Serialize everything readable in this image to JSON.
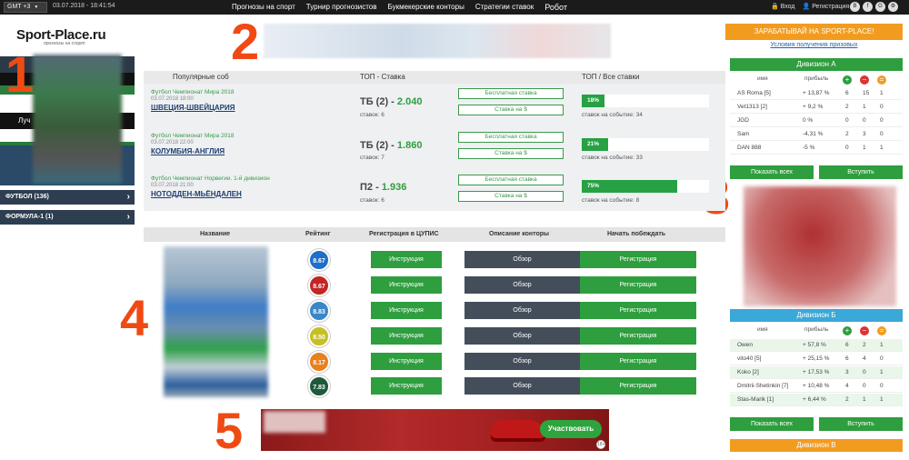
{
  "topbar": {
    "timezone": "GMT +3",
    "datetime": "03.07.2018 - 18:41:54",
    "nav": [
      "Прогнозы на спорт",
      "Турнир прогнозистов",
      "Букмекерские конторы",
      "Стратегии ставок",
      "Робот"
    ],
    "login": "Вход",
    "register": "Регистрация",
    "social": [
      "В",
      "f",
      "G",
      "⚙"
    ]
  },
  "logo": {
    "main": "Sport-Place.ru",
    "sub": "прогнозы на спорт"
  },
  "sidebar": {
    "partial_label": "Луч",
    "sports": [
      {
        "label": "ФУТБОЛ (136)"
      },
      {
        "label": "ФОРМУЛА-1 (1)"
      }
    ]
  },
  "annotations": [
    "1",
    "2",
    "3",
    "4",
    "5"
  ],
  "popular": {
    "header": {
      "events": "Популярные соб",
      "top_bet": "ТОП - Ставка",
      "top_all": "ТОП / Все ставки"
    },
    "events": [
      {
        "league": "Футбол Чемпионат Мира 2018",
        "date": "03.07.2018 18:00",
        "title": "ШВЕЦИЯ-ШВЕЙЦАРИЯ",
        "bet": "ТБ (2) -",
        "odds": "2.040",
        "bets_count": "ставок: 6",
        "free_bet": "Бесплатная ставка",
        "money_bet": "Ставка на $",
        "percent": "18%",
        "percent_value": 18,
        "bets_on_event": "ставок на событие: 34"
      },
      {
        "league": "Футбол Чемпионат Мира 2018",
        "date": "03.07.2018 22:00",
        "title": "КОЛУМБИЯ-АНГЛИЯ",
        "bet": "ТБ (2) -",
        "odds": "1.860",
        "bets_count": "ставок: 7",
        "free_bet": "Бесплатная ставка",
        "money_bet": "Ставка на $",
        "percent": "21%",
        "percent_value": 21,
        "bets_on_event": "ставок на событие: 33"
      },
      {
        "league": "Футбол Чемпионат Норвегии. 1-й дивизион",
        "date": "03.07.2018 21:00",
        "title": "НОТОДДЕН-МЬЁНДАЛЕН",
        "bet": "П2 -",
        "odds": "1.936",
        "bets_count": "ставок: 6",
        "free_bet": "Бесплатная ставка",
        "money_bet": "Ставка на $",
        "percent": "75%",
        "percent_value": 75,
        "bets_on_event": "ставок на событие: 8"
      }
    ]
  },
  "bookmakers": {
    "header": {
      "name": "Название",
      "rating": "Рейтинг",
      "registration": "Регистрация в ЦУПИС",
      "description": "Описание конторы",
      "start": "Начать побеждать"
    },
    "rows": [
      {
        "rating": "8.67",
        "color": "#1e6fc8",
        "instruction": "Инструкция",
        "review": "Обзор",
        "register": "Регистрация"
      },
      {
        "rating": "8.67",
        "color": "#c42424",
        "instruction": "Инструкция",
        "review": "Обзор",
        "register": "Регистрация"
      },
      {
        "rating": "8.83",
        "color": "#3a86c8",
        "instruction": "Инструкция",
        "review": "Обзор",
        "register": "Регистрация"
      },
      {
        "rating": "8.50",
        "color": "#c8c020",
        "instruction": "Инструкция",
        "review": "Обзор",
        "register": "Регистрация"
      },
      {
        "rating": "8.17",
        "color": "#e8801c",
        "instruction": "Инструкция",
        "review": "Обзор",
        "register": "Регистрация"
      },
      {
        "rating": "7.83",
        "color": "#1e5a3a",
        "instruction": "Инструкция",
        "review": "Обзор",
        "register": "Регистрация"
      }
    ]
  },
  "banner": {
    "participate": "Участвовать",
    "badge": "18+"
  },
  "right": {
    "earn": "ЗАРАБАТЫВАЙ НА SPORT-PLACE!",
    "earn_link": "Условия получения призовых",
    "columns": {
      "name": "имя",
      "profit": "прибыль"
    },
    "division_a": {
      "title": "Дивизион А",
      "color": "#2e9e3e",
      "rows": [
        {
          "name": "AS Roma [5]",
          "profit": "+ 13,87 %",
          "w": "6",
          "l": "15",
          "d": "1"
        },
        {
          "name": "Vet1313 [2]",
          "profit": "+ 9,2 %",
          "w": "2",
          "l": "1",
          "d": "0"
        },
        {
          "name": "JGD",
          "profit": "0 %",
          "w": "0",
          "l": "0",
          "d": "0"
        },
        {
          "name": "Sam",
          "profit": "-4,31 %",
          "w": "2",
          "l": "3",
          "d": "0"
        },
        {
          "name": "DAN 888",
          "profit": "-5 %",
          "w": "0",
          "l": "1",
          "d": "1"
        }
      ],
      "show_all": "Показать всех",
      "join": "Вступить"
    },
    "division_b": {
      "title": "Дивизион Б",
      "color": "#3aa8d8",
      "rows": [
        {
          "name": "Owen",
          "profit": "+ 57,8 %",
          "w": "6",
          "l": "2",
          "d": "1"
        },
        {
          "name": "vito40 [5]",
          "profit": "+ 25,15 %",
          "w": "6",
          "l": "4",
          "d": "0"
        },
        {
          "name": "Koko [2]",
          "profit": "+ 17,53 %",
          "w": "3",
          "l": "0",
          "d": "1"
        },
        {
          "name": "Dmitrii-Shetinkin [7]",
          "profit": "+ 10,48 %",
          "w": "4",
          "l": "0",
          "d": "0"
        },
        {
          "name": "Stas-Marik [1]",
          "profit": "+ 6,44 %",
          "w": "2",
          "l": "1",
          "d": "1"
        }
      ],
      "show_all": "Показать всех",
      "join": "Вступить"
    },
    "division_c": {
      "title": "Дивизион В",
      "color": "#f29c1f"
    }
  }
}
